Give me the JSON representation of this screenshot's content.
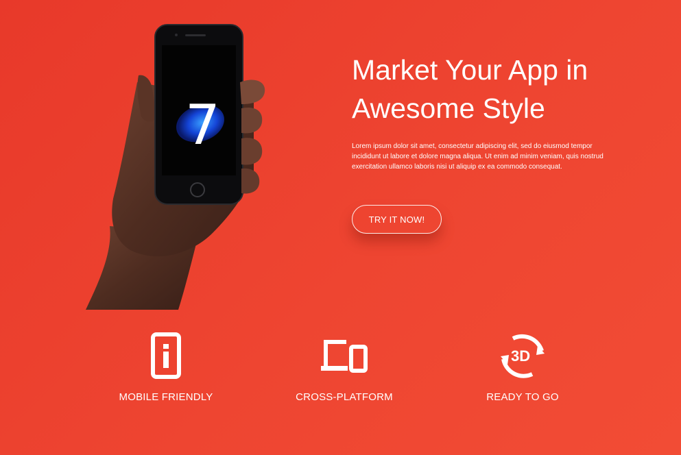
{
  "hero": {
    "heading_line1": "Market Your App in",
    "heading_line2": "Awesome Style",
    "description": "Lorem ipsum dolor sit amet, consectetur adipiscing elit, sed do eiusmod tempor incididunt ut labore et dolore magna aliqua. Ut enim ad minim veniam, quis nostrud exercitation ullamco laboris nisi ut aliquip ex ea commodo consequat.",
    "cta_label": "TRY IT NOW!",
    "phone_screen_digit": "7",
    "image_icon": "hand-holding-phone-image"
  },
  "features": [
    {
      "icon": "mobile-info-icon",
      "label": "MOBILE FRIENDLY"
    },
    {
      "icon": "cross-platform-devices-icon",
      "label": "CROSS-PLATFORM"
    },
    {
      "icon": "rotate-3d-icon",
      "label": "READY TO GO",
      "icon_text": "3D"
    }
  ],
  "colors": {
    "background": "#ee4531",
    "text": "#ffffff"
  }
}
